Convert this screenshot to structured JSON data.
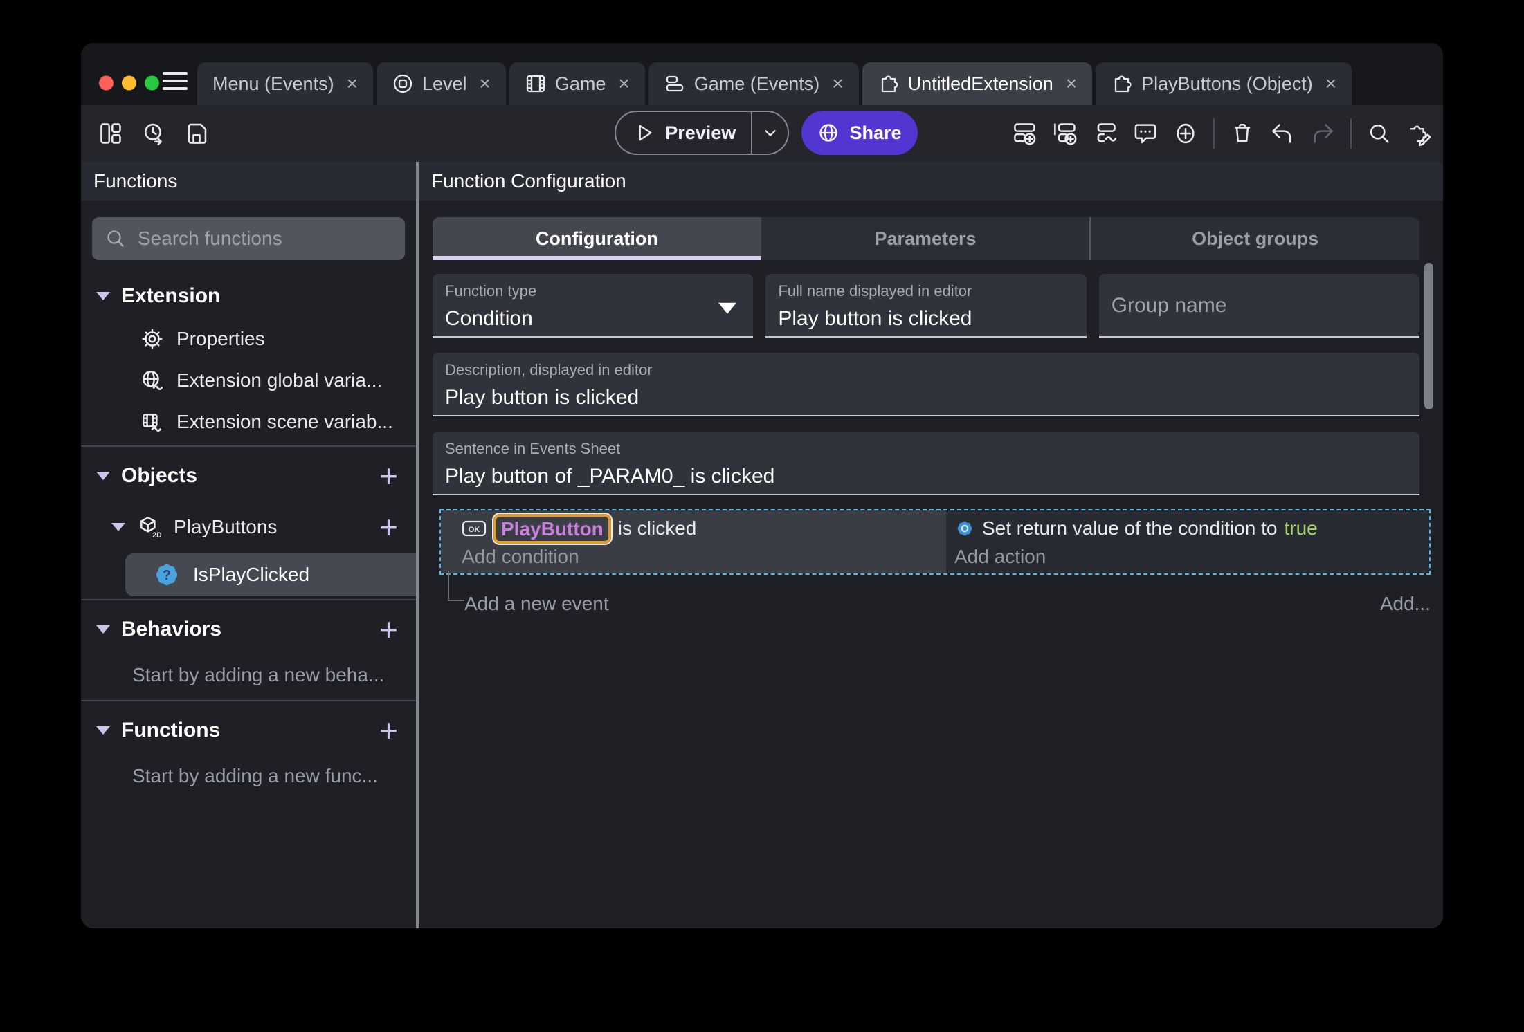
{
  "ui": {
    "close": "×",
    "plus": "+"
  },
  "tabs": [
    {
      "label": "Menu (Events)"
    },
    {
      "label": "Level",
      "icon": "scene-icon"
    },
    {
      "label": "Game",
      "icon": "film-icon"
    },
    {
      "label": "Game (Events)",
      "icon": "events-sheet-icon"
    },
    {
      "label": "UntitledExtension",
      "icon": "extension-icon",
      "active": true
    },
    {
      "label": "PlayButtons (Object)",
      "icon": "extension-icon"
    }
  ],
  "toolbar": {
    "preview": "Preview",
    "share": "Share"
  },
  "sidebar": {
    "title": "Functions",
    "search_placeholder": "Search functions",
    "sections": {
      "extension": {
        "label": "Extension",
        "items": [
          {
            "label": "Properties",
            "icon": "gear-icon"
          },
          {
            "label": "Extension global varia...",
            "icon": "globe-variable-icon"
          },
          {
            "label": "Extension scene variab...",
            "icon": "scene-variable-icon"
          }
        ]
      },
      "objects": {
        "label": "Objects",
        "items": [
          {
            "label": "PlayButtons",
            "icon": "object-2d-icon"
          }
        ],
        "sub": {
          "label": "IsPlayClicked",
          "icon": "function-gear-icon",
          "selected": true
        }
      },
      "behaviors": {
        "label": "Behaviors",
        "note": "Start by adding a new beha..."
      },
      "functions": {
        "label": "Functions",
        "note": "Start by adding a new func..."
      }
    }
  },
  "main": {
    "title": "Function Configuration",
    "tabs": [
      {
        "label": "Configuration",
        "active": true
      },
      {
        "label": "Parameters"
      },
      {
        "label": "Object groups"
      }
    ],
    "fields": {
      "function_type": {
        "label": "Function type",
        "value": "Condition"
      },
      "full_name": {
        "label": "Full name displayed in editor",
        "value": "Play button is clicked"
      },
      "group_name": {
        "placeholder": "Group name"
      },
      "description": {
        "label": "Description, displayed in editor",
        "value": "Play button is clicked"
      },
      "sentence": {
        "label": "Sentence in Events Sheet",
        "value": "Play button of _PARAM0_ is clicked"
      }
    },
    "events": {
      "condition_ok": "OK",
      "condition_object": "PlayButton",
      "condition_suffix": "is clicked",
      "add_condition": "Add condition",
      "action_prefix": "Set return value of the condition to",
      "action_value": "true",
      "add_action": "Add action",
      "add_new_event": "Add a new event",
      "add_more": "Add..."
    }
  },
  "colors": {
    "accent_purple": "#5335d2",
    "param_text": "#cb7fdd",
    "param_border": "#e09a2f",
    "true_green": "#a6d468",
    "selection_dashed_blue": "#4fb8ea",
    "tab_underline": "#d9d2f3"
  }
}
